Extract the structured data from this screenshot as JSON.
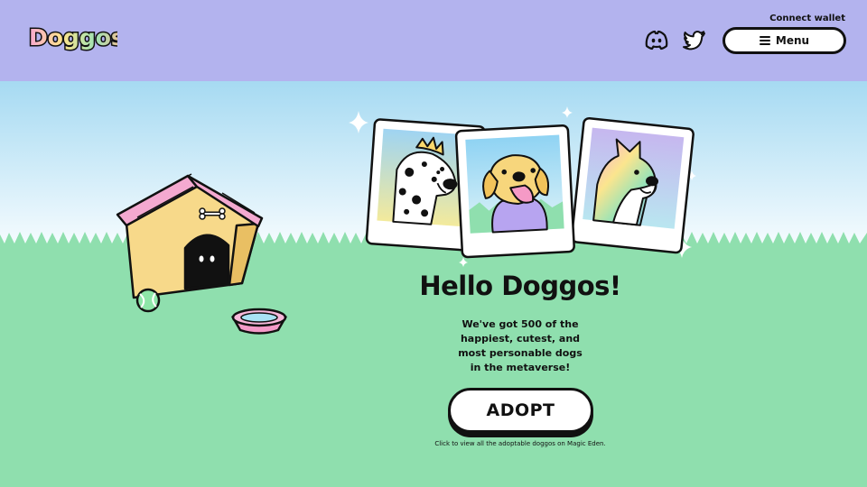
{
  "header": {
    "logo_text": "Doggos",
    "connect_wallet": "Connect wallet",
    "menu_label": "Menu",
    "social": [
      "discord-icon",
      "twitter-icon"
    ]
  },
  "hero": {
    "title": "Hello Doggos!",
    "description_lines": [
      "We've got 500 of the",
      "happiest, cutest, and",
      "most personable dogs",
      "in the metaverse!"
    ],
    "adopt_label": "ADOPT",
    "caption": "Click to view all the adoptable doggos on Magic Eden."
  },
  "colors": {
    "header_bg": "#b3b3ee",
    "sky_top": "#a8dcf2",
    "grass": "#8fdfae",
    "outline": "#111111",
    "doghouse_roof": "#f4a9d0",
    "doghouse_body": "#f7d98a",
    "bowl": "#f49ac8"
  }
}
